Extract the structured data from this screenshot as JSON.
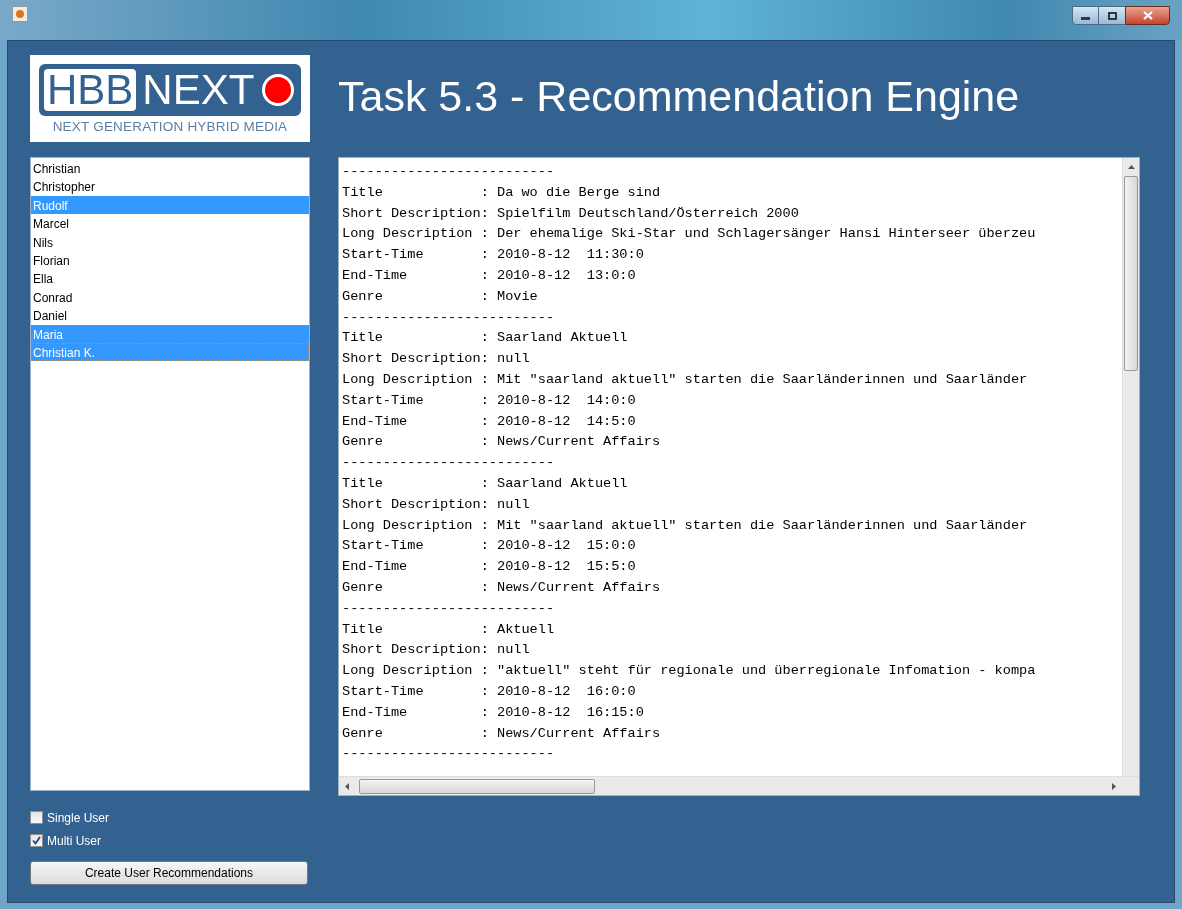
{
  "logo": {
    "wordmark_left": "HBB",
    "wordmark_right": "NEXT",
    "tagline": "NEXT GENERATION HYBRID MEDIA"
  },
  "heading": "Task 5.3 - Recommendation Engine",
  "users": [
    {
      "name": "Christian",
      "selected": false,
      "focused": false
    },
    {
      "name": "Christopher",
      "selected": false,
      "focused": false
    },
    {
      "name": "Rudolf",
      "selected": true,
      "focused": false
    },
    {
      "name": "Marcel",
      "selected": false,
      "focused": false
    },
    {
      "name": "Nils",
      "selected": false,
      "focused": false
    },
    {
      "name": "Florian",
      "selected": false,
      "focused": false
    },
    {
      "name": "Ella",
      "selected": false,
      "focused": false
    },
    {
      "name": "Conrad",
      "selected": false,
      "focused": false
    },
    {
      "name": "Daniel",
      "selected": false,
      "focused": false
    },
    {
      "name": "Maria",
      "selected": true,
      "focused": false
    },
    {
      "name": "Christian K.",
      "selected": true,
      "focused": true
    }
  ],
  "options": [
    {
      "label": "Single User",
      "checked": false
    },
    {
      "label": "Multi User",
      "checked": true
    }
  ],
  "create_button": "Create User Recommendations",
  "output_lines": [
    "--------------------------",
    "Title            : Da wo die Berge sind",
    "Short Description: Spielfilm Deutschland/Österreich 2000",
    "Long Description : Der ehemalige Ski-Star und Schlagersänger Hansi Hinterseer überzeu",
    "Start-Time       : 2010-8-12  11:30:0",
    "End-Time         : 2010-8-12  13:0:0",
    "Genre            : Movie",
    "--------------------------",
    "Title            : Saarland Aktuell",
    "Short Description: null",
    "Long Description : Mit \"saarland aktuell\" starten die Saarländerinnen und Saarländer",
    "Start-Time       : 2010-8-12  14:0:0",
    "End-Time         : 2010-8-12  14:5:0",
    "Genre            : News/Current Affairs",
    "--------------------------",
    "Title            : Saarland Aktuell",
    "Short Description: null",
    "Long Description : Mit \"saarland aktuell\" starten die Saarländerinnen und Saarländer",
    "Start-Time       : 2010-8-12  15:0:0",
    "End-Time         : 2010-8-12  15:5:0",
    "Genre            : News/Current Affairs",
    "--------------------------",
    "Title            : Aktuell",
    "Short Description: null",
    "Long Description : \"aktuell\" steht für regionale und überregionale Infomation - kompa",
    "Start-Time       : 2010-8-12  16:0:0",
    "End-Time         : 2010-8-12  16:15:0",
    "Genre            : News/Current Affairs",
    "--------------------------"
  ]
}
